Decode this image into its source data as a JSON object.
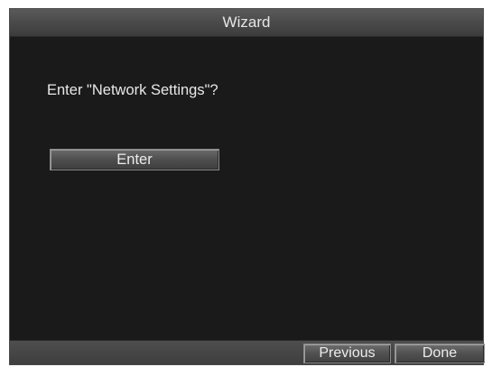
{
  "window": {
    "title": "Wizard"
  },
  "main": {
    "prompt": "Enter \"Network Settings\"?",
    "enter_label": "Enter"
  },
  "footer": {
    "previous_label": "Previous",
    "done_label": "Done"
  }
}
